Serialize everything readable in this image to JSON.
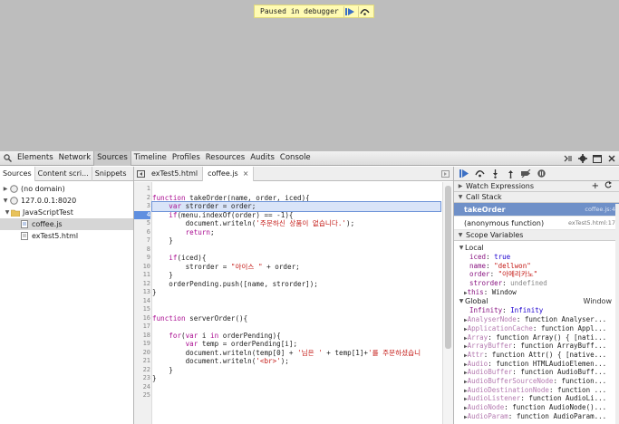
{
  "paused_banner": {
    "text": "Paused in debugger"
  },
  "toolbar": {
    "tabs": [
      "Elements",
      "Network",
      "Sources",
      "Timeline",
      "Profiles",
      "Resources",
      "Audits",
      "Console"
    ],
    "active_tab": "Sources"
  },
  "navigator": {
    "tabs": [
      "Sources",
      "Content scri...",
      "Snippets"
    ],
    "items": [
      "(no domain)",
      "127.0.0.1:8020",
      "JavaScriptTest",
      "coffee.js",
      "exTest5.html"
    ]
  },
  "editor": {
    "tabs": [
      "exTest5.html",
      "coffee.js"
    ],
    "close_glyph": "×",
    "line_numbers": [
      "1",
      "2",
      "3",
      "4",
      "5",
      "6",
      "7",
      "8",
      "9",
      "10",
      "11",
      "12",
      "13",
      "14",
      "15",
      "16",
      "17",
      "18",
      "19",
      "20",
      "21",
      "22",
      "23",
      "24",
      "25"
    ],
    "execution_line": 4
  },
  "debugger": {
    "watch_label": "Watch Expressions",
    "call_stack_label": "Call Stack",
    "frames": [
      {
        "name": "takeOrder",
        "location": "coffee.js:4"
      },
      {
        "name": "(anonymous function)",
        "location": "exTest5.html:17"
      }
    ],
    "scope_label": "Scope Variables",
    "local_label": "Local",
    "local_props": [
      {
        "k": "iced",
        "v": "true",
        "t": "n"
      },
      {
        "k": "name",
        "v": "\"dellwon\"",
        "t": "s"
      },
      {
        "k": "order",
        "v": "\"아메리카노\"",
        "t": "s"
      },
      {
        "k": "strorder",
        "v": "undefined",
        "t": "u"
      },
      {
        "k": "this",
        "v": "Window",
        "t": ""
      }
    ],
    "global_label": "Global",
    "global_value": "Window",
    "global_props": [
      {
        "k": "Infinity",
        "v": "Infinity"
      },
      {
        "k": "AnalyserNode",
        "v": "function Analyser..."
      },
      {
        "k": "ApplicationCache",
        "v": "function Appl..."
      },
      {
        "k": "Array",
        "v": "function Array() { [nati..."
      },
      {
        "k": "ArrayBuffer",
        "v": "function ArrayBuff..."
      },
      {
        "k": "Attr",
        "v": "function Attr() { [native..."
      },
      {
        "k": "Audio",
        "v": "function HTMLAudioElemen..."
      },
      {
        "k": "AudioBuffer",
        "v": "function AudioBuff..."
      },
      {
        "k": "AudioBufferSourceNode",
        "v": "function..."
      },
      {
        "k": "AudioDestinationNode",
        "v": "function ..."
      },
      {
        "k": "AudioListener",
        "v": "function AudioLi..."
      },
      {
        "k": "AudioNode",
        "v": "function AudioNode()..."
      },
      {
        "k": "AudioParam",
        "v": "function AudioParam..."
      }
    ]
  },
  "colors": {
    "accent": "#6f90c8",
    "exec_line": "#d9e4f8",
    "keyword": "#aa0d91",
    "string": "#c41a16"
  }
}
